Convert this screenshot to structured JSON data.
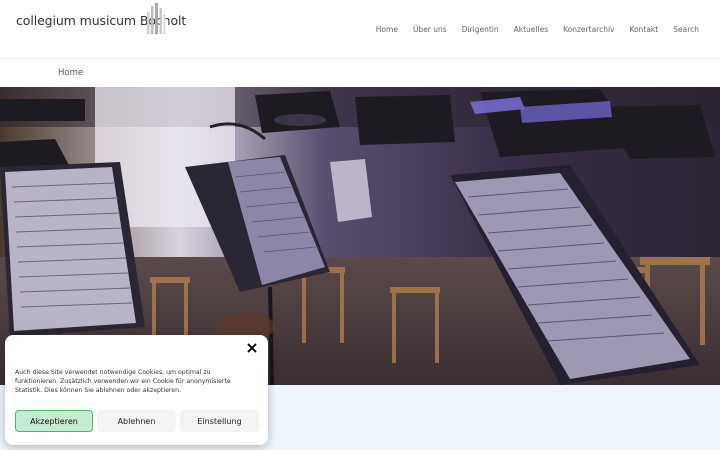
{
  "site": {
    "title": "collegium musicum Bocholt"
  },
  "nav": {
    "items": [
      "Home",
      "Über uns",
      "Dirigentin",
      "Aktuelles",
      "Konzertarchiv",
      "Kontakt",
      "Search"
    ]
  },
  "breadcrumb": {
    "current": "Home"
  },
  "hero": {
    "image": "orchestra music stands with sheet music"
  },
  "cookie": {
    "text": "Auch diese Site verwendet notwendige Cookies, um optimal zu funktionieren. Zusätzlich verwenden wir ein Cookie für anonymisierte Statistik. Dies können Sie ablehnen oder akzeptieren.",
    "accept_label": "Akzeptieren",
    "deny_label": "Ablehnen",
    "settings_label": "Einstellung"
  },
  "colors": {
    "accept_bg": "#c4ecd0",
    "accept_border": "#53b26d",
    "below_bg": "#eef6fc"
  }
}
